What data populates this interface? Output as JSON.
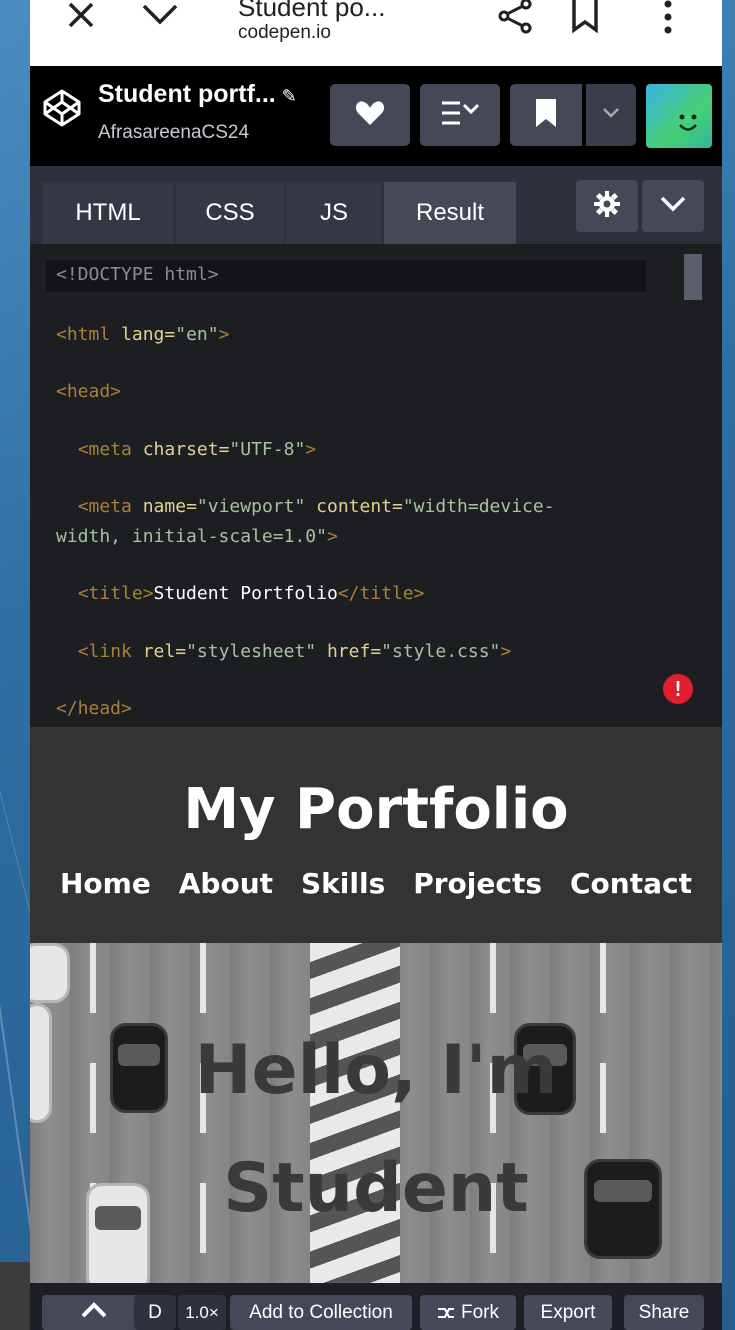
{
  "browser": {
    "tab_title": "Student po...",
    "domain": "codepen.io"
  },
  "header": {
    "pen_title": "Student portf...",
    "pencil": "✎",
    "author": "AfrasareenaCS24"
  },
  "editor": {
    "tabs": [
      "HTML",
      "CSS",
      "JS",
      "Result"
    ],
    "active_tab": "HTML"
  },
  "code": {
    "doctype": "<!DOCTYPE html>",
    "lines": [
      {
        "tag_open": "<html",
        "attr": "lang",
        "val": "\"en\"",
        "tag_close": ">"
      },
      {
        "tag": "<head>"
      },
      {
        "tag_open": "<meta",
        "attr": "charset",
        "val": "\"UTF-8\"",
        "tag_close": ">"
      },
      {
        "tag_open": "<meta",
        "attr1": "name",
        "val1": "\"viewport\"",
        "attr2": "content",
        "val2a": "\"width=device-",
        "val2b": "width, initial-scale=1.0\"",
        "tag_close": ">"
      },
      {
        "tag_open": "<title>",
        "text": "Student Portfolio",
        "tag_close": "</title>"
      },
      {
        "tag_open": "<link",
        "attr1": "rel",
        "val1": "\"stylesheet\"",
        "attr2": "href",
        "val2": "\"style.css\"",
        "tag_close": ">"
      },
      {
        "tag": "</head>"
      }
    ],
    "error_mark": "!"
  },
  "preview": {
    "title": "My Portfolio",
    "nav": [
      "Home",
      "About",
      "Skills",
      "Projects",
      "Contact"
    ],
    "hero_line1": "Hello, I'm",
    "hero_line2": "Student"
  },
  "bottom_bar": {
    "partial": "D",
    "zoom": "1.0×",
    "add_to_collection": "Add to Collection",
    "fork": "Fork",
    "export": "Export",
    "share": "Share"
  },
  "colors": {
    "codepen_black": "#000000",
    "button_gray": "#444857",
    "editor_bg": "#1d1e22",
    "error_red": "#e01e2e"
  }
}
